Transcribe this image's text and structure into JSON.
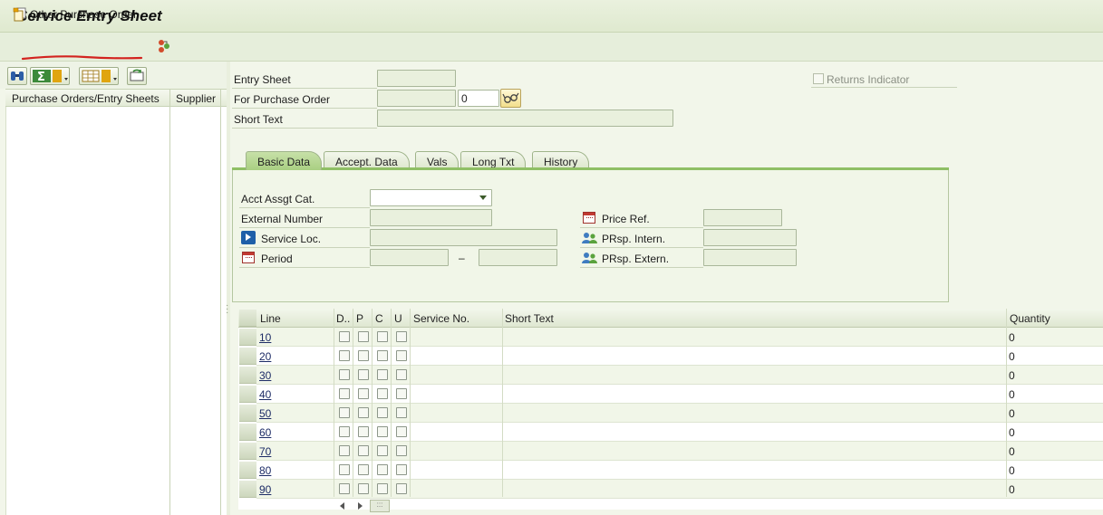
{
  "window": {
    "title": "Service Entry Sheet"
  },
  "toolbar": {
    "other_po_label": "Other Purchase Order"
  },
  "left_pane": {
    "columns": [
      "Purchase Orders/Entry Sheets",
      "Supplier"
    ]
  },
  "header": {
    "entry_sheet_label": "Entry Sheet",
    "entry_sheet_value": "",
    "po_label": "For Purchase Order",
    "po_value": "",
    "po_item_value": "0",
    "short_text_label": "Short Text",
    "short_text_value": "",
    "returns_indicator_label": "Returns Indicator"
  },
  "tabs": [
    {
      "label": "Basic Data",
      "active": true
    },
    {
      "label": "Accept. Data",
      "active": false
    },
    {
      "label": "Vals",
      "active": false
    },
    {
      "label": "Long Txt",
      "active": false
    },
    {
      "label": "History",
      "active": false
    }
  ],
  "basic_data": {
    "acct_assgt_label": "Acct Assgt Cat.",
    "acct_assgt_value": "",
    "external_number_label": "External Number",
    "service_loc_label": "Service Loc.",
    "period_label": "Period",
    "period_separator": "–",
    "price_ref_label": "Price Ref.",
    "prsp_intern_label": "PRsp. Intern.",
    "prsp_extern_label": "PRsp. Extern."
  },
  "table": {
    "columns": [
      "Line",
      "D..",
      "P",
      "C",
      "U",
      "Service No.",
      "Short Text",
      "Quantity"
    ],
    "rows": [
      {
        "line": "10",
        "quantity": "0"
      },
      {
        "line": "20",
        "quantity": "0"
      },
      {
        "line": "30",
        "quantity": "0"
      },
      {
        "line": "40",
        "quantity": "0"
      },
      {
        "line": "50",
        "quantity": "0"
      },
      {
        "line": "60",
        "quantity": "0"
      },
      {
        "line": "70",
        "quantity": "0"
      },
      {
        "line": "80",
        "quantity": "0"
      },
      {
        "line": "90",
        "quantity": "0"
      }
    ]
  },
  "colors": {
    "accent_green": "#a9cf82",
    "annotation_red": "#d3231f",
    "link_blue": "#1d2c66"
  }
}
